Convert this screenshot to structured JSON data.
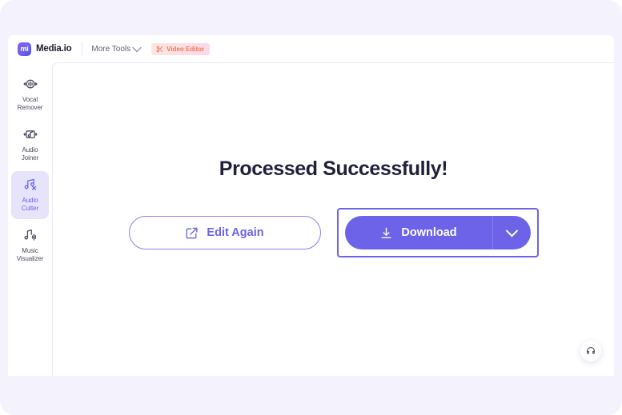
{
  "theme": {
    "accent": "#6C63E8",
    "accent_light": "#8A83EE",
    "page_bg": "#F4F2FD",
    "panel_bg": "#FFFFFF",
    "active_item_bg": "#E6E3FB",
    "headline_color": "#20203C",
    "badge_color": "#F2795F"
  },
  "header": {
    "logo_mark_text": "mi",
    "logo_mark_name": "media-io-logo-icon",
    "brand": "Media.io",
    "more_tools_label": "More Tools",
    "more_tools_icon": "chevron-down-icon",
    "badge": {
      "label": "Video Editor",
      "icon": "scissors-icon"
    }
  },
  "sidebar": {
    "items": [
      {
        "label_line1": "Vocal",
        "label_line2": "Remover",
        "icon": "vocal-remover-icon",
        "active": false
      },
      {
        "label_line1": "Audio",
        "label_line2": "Joiner",
        "icon": "audio-joiner-icon",
        "active": false
      },
      {
        "label_line1": "Audio",
        "label_line2": "Cutter",
        "icon": "audio-cutter-icon",
        "active": true
      },
      {
        "label_line1": "Music",
        "label_line2": "Visualizer",
        "icon": "music-visualizer-icon",
        "active": false
      }
    ]
  },
  "main": {
    "headline": "Processed Successfully!",
    "edit_button": {
      "label": "Edit Again",
      "icon": "edit-square-icon"
    },
    "download_button": {
      "label": "Download",
      "icon": "download-arrow-icon",
      "dropdown_icon": "chevron-down-icon",
      "focused": true
    },
    "support_fab": {
      "icon": "headset-support-icon"
    }
  }
}
